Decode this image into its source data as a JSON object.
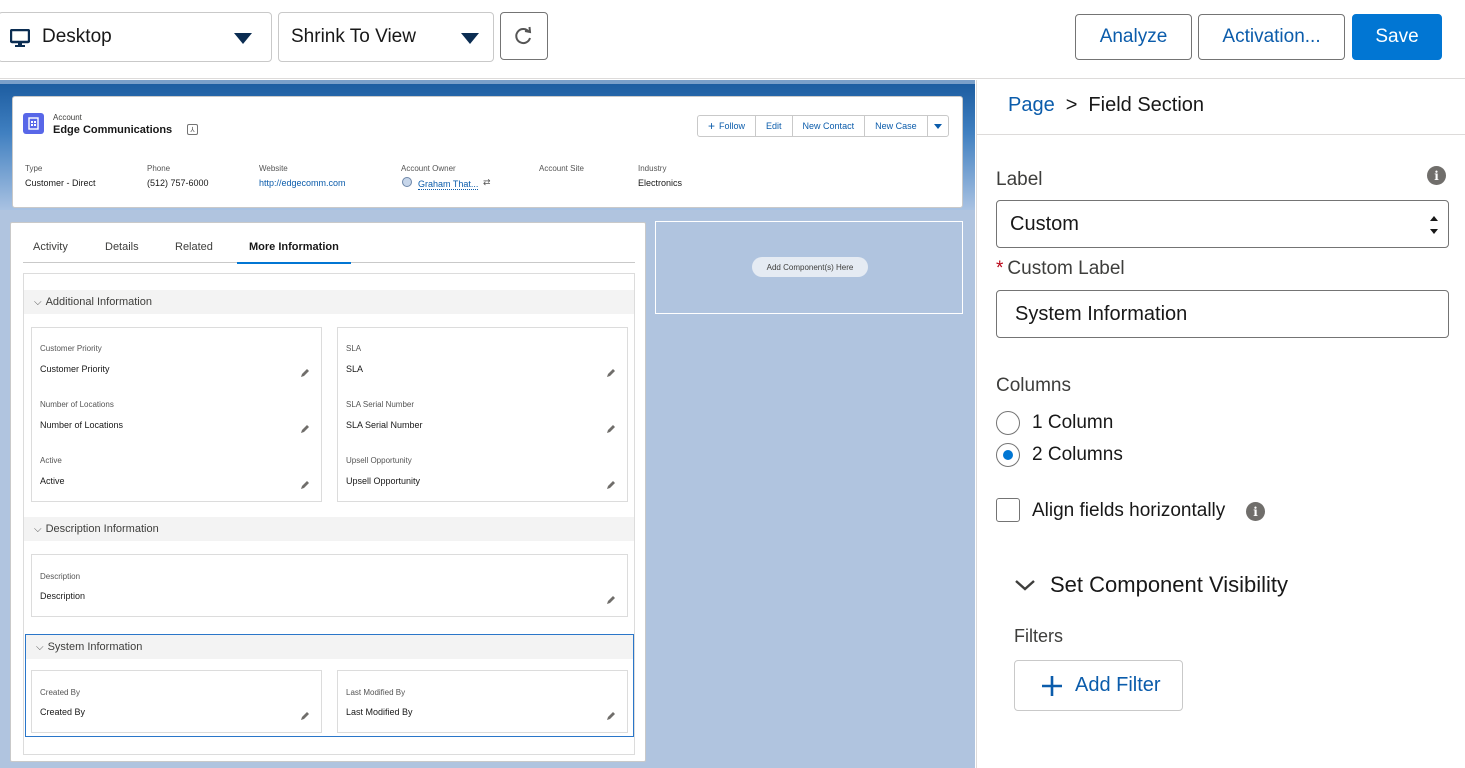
{
  "toolbar": {
    "device_label": "Desktop",
    "zoom_label": "Shrink To View",
    "analyze_label": "Analyze",
    "activation_label": "Activation...",
    "save_label": "Save"
  },
  "record": {
    "object_label": "Account",
    "name": "Edge Communications",
    "actions": [
      "Follow",
      "Edit",
      "New Contact",
      "New Case"
    ],
    "fields": [
      {
        "label": "Type",
        "value": "Customer - Direct"
      },
      {
        "label": "Phone",
        "value": "(512) 757-6000"
      },
      {
        "label": "Website",
        "value": "http://edgecomm.com"
      },
      {
        "label": "Account Owner",
        "value": "Graham That..."
      },
      {
        "label": "Account Site",
        "value": ""
      },
      {
        "label": "Industry",
        "value": "Electronics"
      }
    ]
  },
  "tabs": [
    "Activity",
    "Details",
    "Related",
    "More Information"
  ],
  "active_tab": "More Information",
  "sections": {
    "additional": {
      "title": "Additional Information",
      "left": [
        {
          "label": "Customer Priority",
          "value": "Customer Priority"
        },
        {
          "label": "Number of Locations",
          "value": "Number of Locations"
        },
        {
          "label": "Active",
          "value": "Active"
        }
      ],
      "right": [
        {
          "label": "SLA",
          "value": "SLA"
        },
        {
          "label": "SLA Serial Number",
          "value": "SLA Serial Number"
        },
        {
          "label": "Upsell Opportunity",
          "value": "Upsell Opportunity"
        }
      ]
    },
    "description": {
      "title": "Description Information",
      "field": {
        "label": "Description",
        "value": "Description"
      }
    },
    "system": {
      "title": "System Information",
      "left": {
        "label": "Created By",
        "value": "Created By"
      },
      "right": {
        "label": "Last Modified By",
        "value": "Last Modified By"
      }
    }
  },
  "sidebar_zone": {
    "add_component_label": "Add Component(s) Here"
  },
  "properties": {
    "breadcrumb_parent": "Page",
    "breadcrumb_separator": ">",
    "breadcrumb_current": "Field Section",
    "label_title": "Label",
    "label_value": "Custom",
    "custom_label_title": "Custom Label",
    "custom_label_value": "System Information",
    "columns_title": "Columns",
    "column_options": [
      "1 Column",
      "2 Columns"
    ],
    "columns_selected": "2 Columns",
    "align_label": "Align fields horizontally",
    "align_checked": false,
    "visibility_title": "Set Component Visibility",
    "filters_title": "Filters",
    "add_filter_label": "Add Filter"
  },
  "colors": {
    "brand": "#0176d3",
    "link": "#0b5cab",
    "canvas": "#b0c4df"
  }
}
